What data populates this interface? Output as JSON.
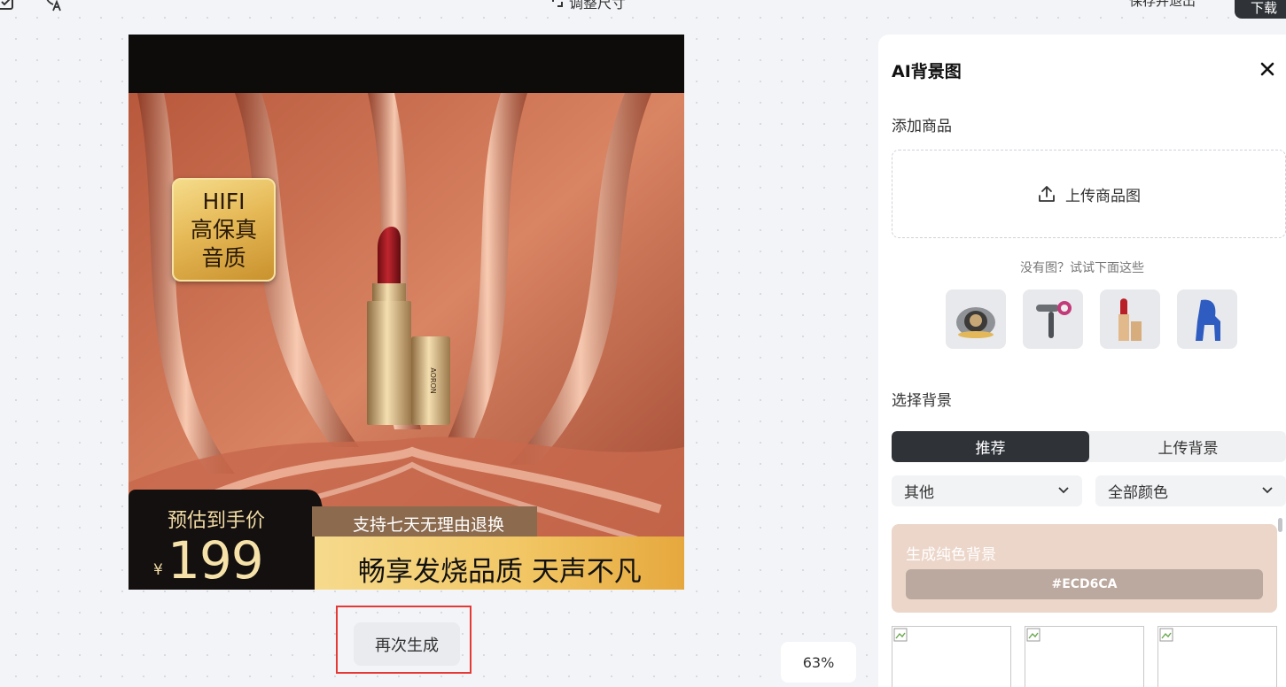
{
  "toolbar": {
    "icons": [
      "checkbox-icon",
      "translate-icon",
      "resize-icon"
    ],
    "resize_label": "调整尺寸",
    "save_exit_label": "保存并退出",
    "download_label": "下载"
  },
  "poster": {
    "badge_lines": [
      "HIFI",
      "高保真",
      "音质"
    ],
    "lipstick_brand": "AORON",
    "price_label": "预估到手价",
    "currency": "¥",
    "price": "199",
    "return_policy": "支持七天无理由退换",
    "slogan": "畅享发烧品质 天声不凡"
  },
  "canvas": {
    "regenerate_label": "再次生成",
    "zoom": "63%"
  },
  "panel": {
    "title": "AI背景图",
    "add_product_label": "添加商品",
    "upload_label": "上传商品图",
    "hint": "没有图？试试下面这些",
    "samples": [
      "cat-bed",
      "hair-dryer",
      "lipstick",
      "blue-chair"
    ],
    "select_bg_label": "选择背景",
    "tabs": [
      "推荐",
      "上传背景"
    ],
    "active_tab": "推荐",
    "category": "其他",
    "color": "全部颜色",
    "solid_bg": {
      "title": "生成纯色背景",
      "hex": "#ECD6CA"
    }
  },
  "colors": {
    "accent_dark": "#2f3338",
    "highlight_red": "#e53935",
    "solid_bg": "#ecd6ca"
  }
}
